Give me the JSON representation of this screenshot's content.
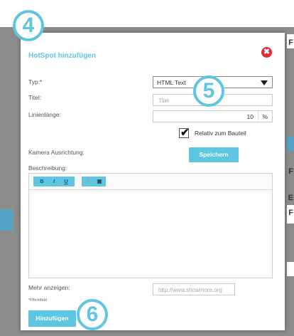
{
  "background": {
    "side_texts": [
      "F",
      "F",
      "E",
      "F"
    ]
  },
  "modal": {
    "title": "HotSpot hinzufügen",
    "close_symbol": "✖",
    "type_label": "Typ:*",
    "type_value": "HTML Text",
    "title_label": "Titel:",
    "title_placeholder": "Titel",
    "line_length_label": "Linienlänge:",
    "line_length_value": "10",
    "line_length_unit": "%",
    "relative_checked": true,
    "relative_label": "Relativ zum Bauteil",
    "camera_label": "Kamera Ausrichtung:",
    "save_label": "Speichern",
    "description_label": "Beschreibung:",
    "toolbar": {
      "bold": "B",
      "italic": "I",
      "underline": "U",
      "link": "🔗",
      "image": "▣"
    },
    "more_label": "Mehr anzeigen:",
    "more_placeholder": "http://www.showmore.org",
    "required_note": "*Pflichtfeld",
    "add_label": "Hinzufügen"
  },
  "steps": {
    "step4": "4",
    "step5": "5",
    "step6": "6"
  },
  "colors": {
    "accent": "#5ec6e0",
    "close": "#e02a35",
    "overlay": "#8c8c8c"
  }
}
